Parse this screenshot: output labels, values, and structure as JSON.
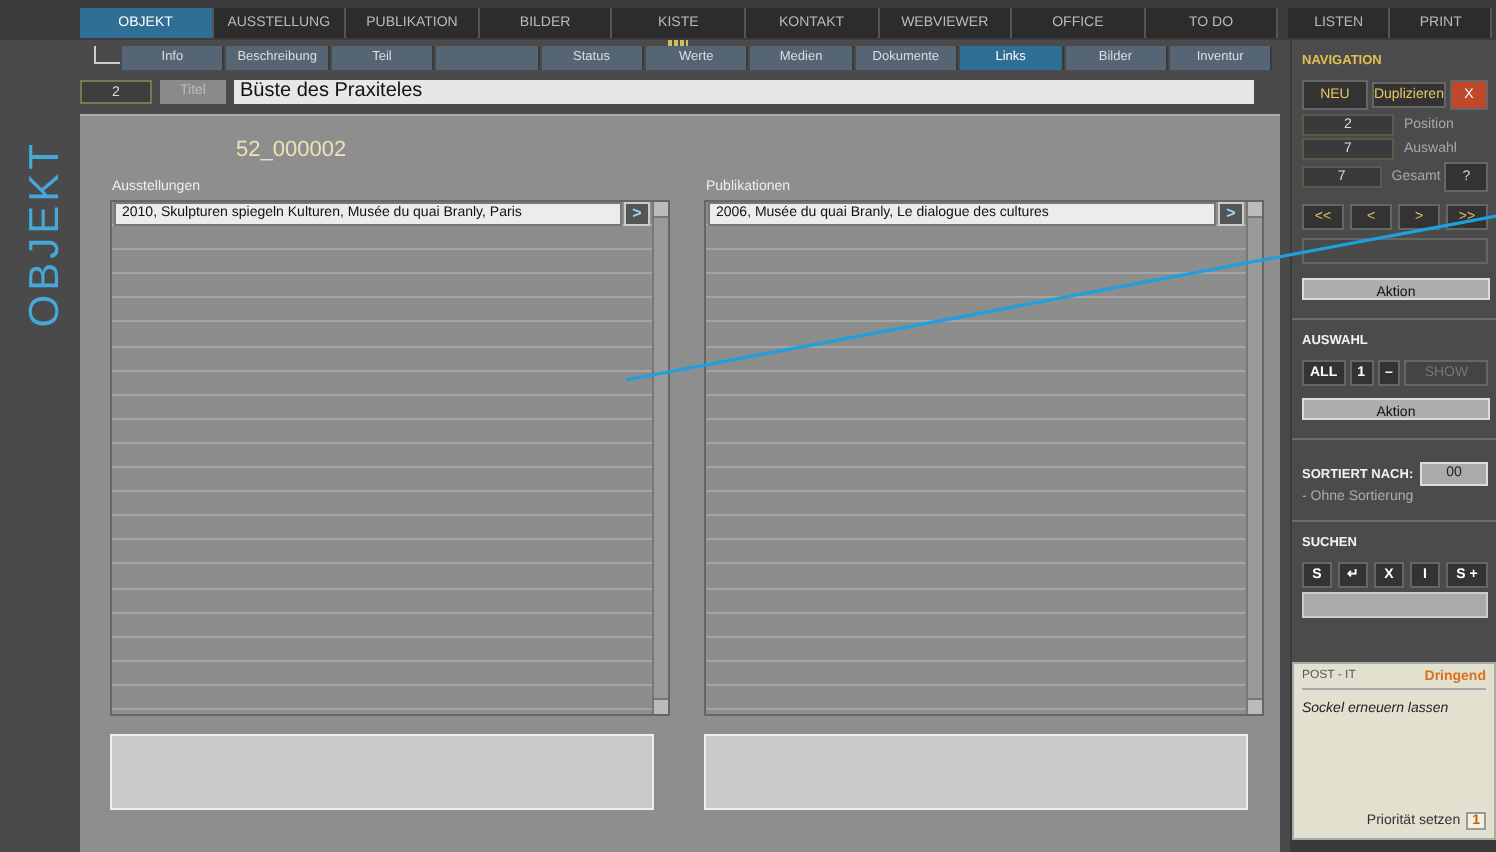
{
  "main_tabs": [
    {
      "label": "OBJEKT",
      "selected": true
    },
    {
      "label": "AUSSTELLUNG",
      "selected": false
    },
    {
      "label": "PUBLIKATION",
      "selected": false
    },
    {
      "label": "BILDER",
      "selected": false
    },
    {
      "label": "KISTE",
      "selected": false,
      "marked": true
    },
    {
      "label": "KONTAKT",
      "selected": false
    },
    {
      "label": "WEBVIEWER",
      "selected": false
    },
    {
      "label": "OFFICE",
      "selected": false
    },
    {
      "label": "TO DO",
      "selected": false
    }
  ],
  "right_tabs": [
    "LISTEN",
    "PRINT"
  ],
  "sub_tabs": [
    {
      "label": "Info",
      "selected": false
    },
    {
      "label": "Beschreibung",
      "selected": false
    },
    {
      "label": "Teil",
      "selected": false
    },
    {
      "selected": false
    },
    {
      "label": "Status",
      "selected": false
    },
    {
      "label": "Werte",
      "selected": false
    },
    {
      "label": "Medien",
      "selected": false
    },
    {
      "label": "Dokumente",
      "selected": false
    },
    {
      "label": "Links",
      "selected": true
    },
    {
      "label": "Bilder",
      "selected": false
    },
    {
      "label": "Inventur",
      "selected": false
    }
  ],
  "side_label": "OBJEKT",
  "record": {
    "number": "2",
    "title_label": "Titel",
    "title": "Büste des Praxiteles",
    "inventory_id": "52_000002"
  },
  "lists": [
    {
      "heading": "Ausstellungen",
      "rows": [
        "2010, Skulpturen spiegeln Kulturen, Musée du quai Branly, Paris"
      ],
      "row_button": ">"
    },
    {
      "heading": "Publikationen",
      "rows": [
        "2006, Musée du quai Branly, Le dialogue des cultures"
      ],
      "row_button": ">"
    }
  ],
  "navigation": {
    "heading": "NAVIGATION",
    "new": "NEU",
    "duplicate": "Duplizieren",
    "delete": "X",
    "counters": [
      {
        "value": "2",
        "label": "Position"
      },
      {
        "value": "7",
        "label": "Auswahl"
      },
      {
        "value": "7",
        "label": "Gesamt"
      }
    ],
    "help": "?",
    "nav_buttons": [
      "<<",
      "<",
      ">",
      ">>"
    ],
    "action": "Aktion"
  },
  "selection": {
    "heading": "AUSWAHL",
    "buttons": [
      {
        "label": "ALL",
        "disabled": false
      },
      {
        "label": "1",
        "disabled": false
      },
      {
        "label": "–",
        "disabled": false
      },
      {
        "label": "SHOW",
        "disabled": true
      }
    ],
    "action": "Aktion"
  },
  "sort": {
    "heading": "SORTIERT NACH:",
    "code": "00",
    "description": "- Ohne Sortierung"
  },
  "search": {
    "heading": "SUCHEN",
    "buttons": [
      "S",
      "↵",
      "X",
      "I",
      "S +"
    ]
  },
  "postit": {
    "heading": "POST - IT",
    "urgency": "Dringend",
    "note": "Sockel erneuern lassen",
    "set_priority": "Priorität setzen",
    "priority": "1"
  }
}
